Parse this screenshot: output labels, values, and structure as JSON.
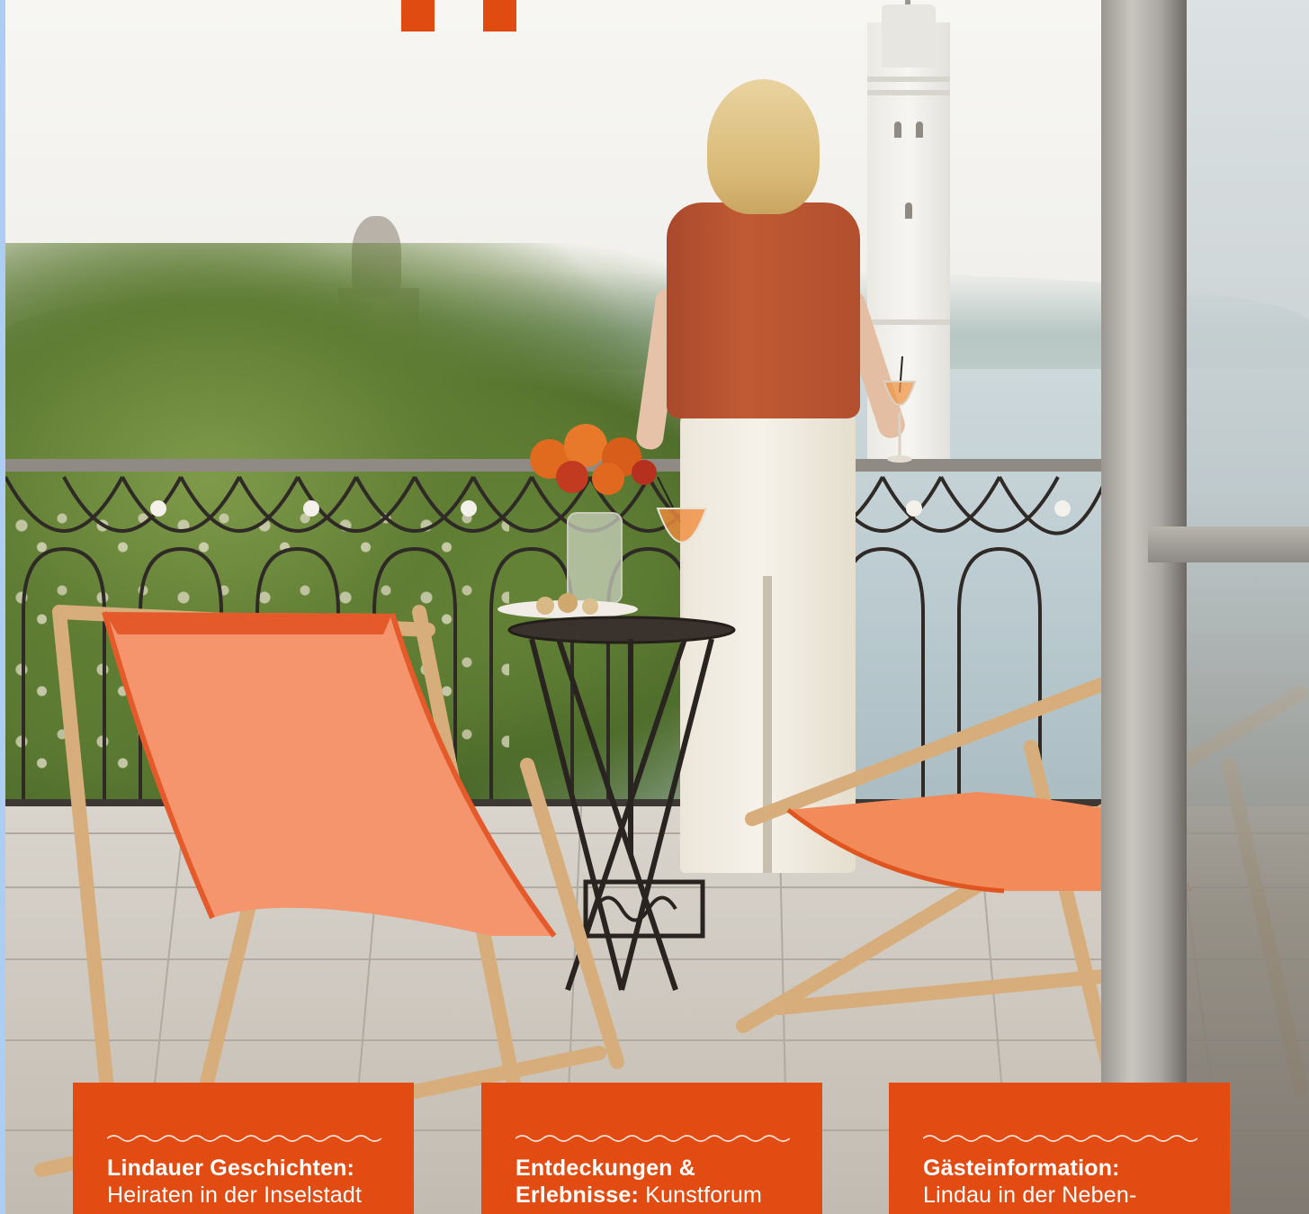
{
  "brand": {
    "accent": "#e24c12",
    "left_edge": "#aecdf2"
  },
  "photo": {
    "icon": "terrace-photo"
  },
  "teasers": [
    {
      "title": "Lindauer Geschichten:",
      "body": "Heiraten in der Inselstadt"
    },
    {
      "title": "Entdeckungen & Erlebnisse:",
      "body": "Kunstforum"
    },
    {
      "title": "Gästeinformation:",
      "body": "Lindau in der Neben-"
    }
  ]
}
